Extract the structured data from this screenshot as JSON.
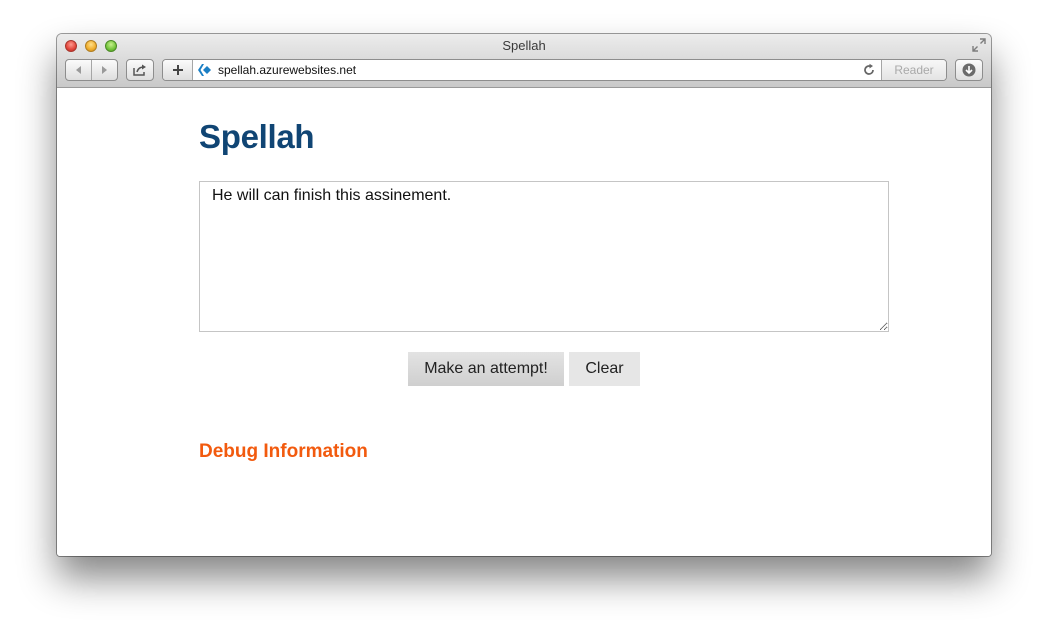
{
  "window": {
    "title": "Spellah"
  },
  "toolbar": {
    "back_icon": "chevron-left-icon",
    "forward_icon": "chevron-right-icon",
    "share_icon": "share-icon",
    "add_icon": "plus-icon",
    "reload_icon": "reload-icon",
    "reader_label": "Reader",
    "download_icon": "download-icon"
  },
  "address": {
    "url": "spellah.azurewebsites.net",
    "site_icon": "azure-diamond-icon"
  },
  "page": {
    "title": "Spellah",
    "input_value": "He will can finish this assinement.",
    "attempt_label": "Make an attempt!",
    "clear_label": "Clear",
    "debug_heading": "Debug Information"
  },
  "colors": {
    "title": "#104574",
    "debug_heading": "#f25a0e",
    "site_icon": "#1b7fc4"
  }
}
